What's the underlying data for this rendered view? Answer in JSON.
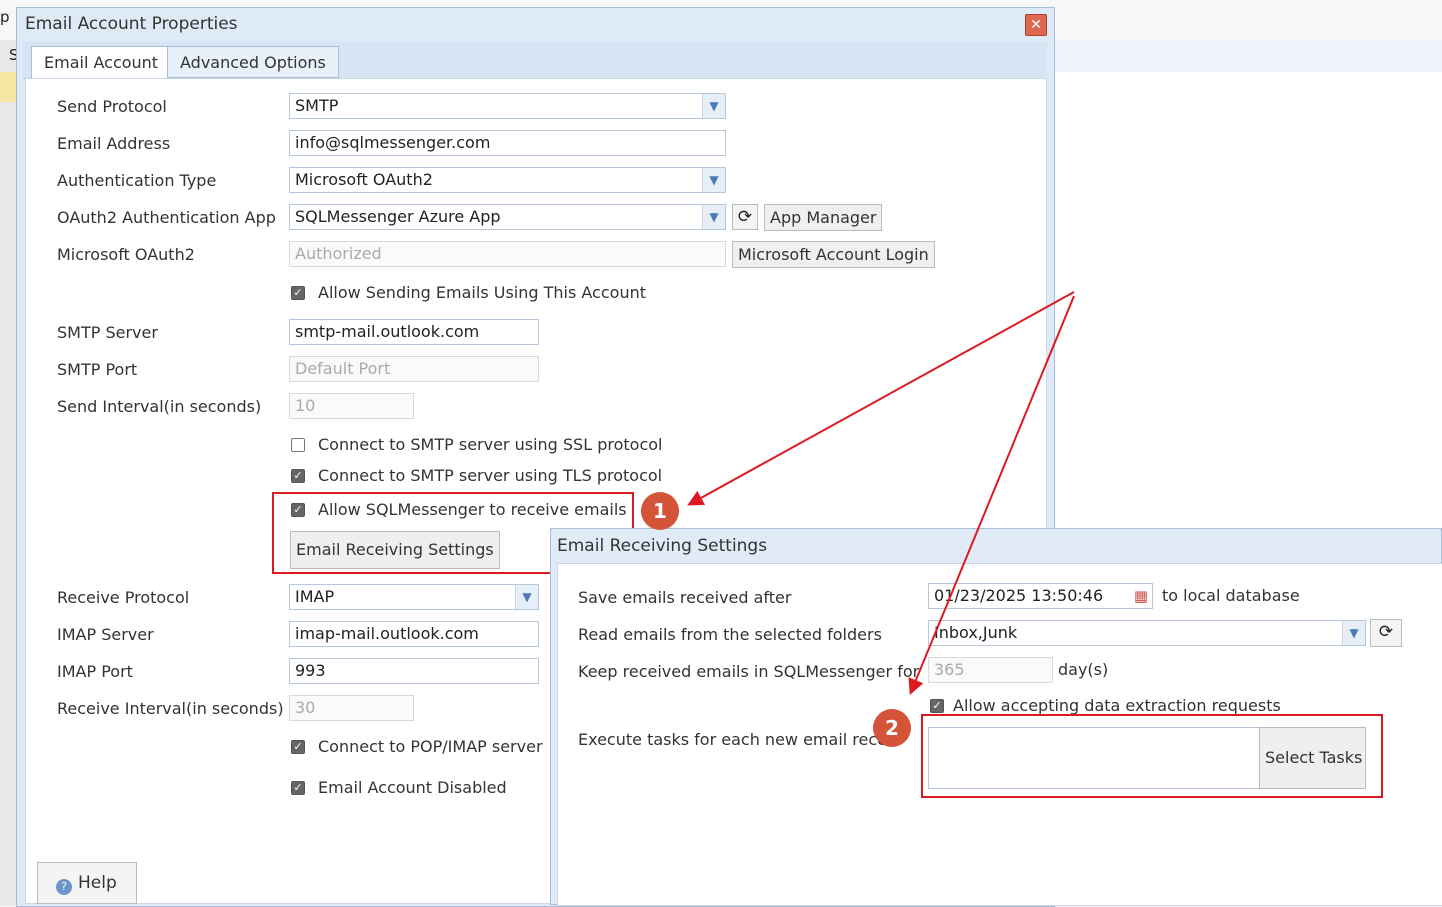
{
  "background": {
    "top_fragment": "p",
    "left_fragment": "S"
  },
  "dialog": {
    "title": "Email Account Properties",
    "close_icon": "close-icon",
    "tabs": [
      {
        "label": "Email Account",
        "active": true
      },
      {
        "label": "Advanced Options",
        "active": false
      }
    ],
    "send_protocol": {
      "label": "Send Protocol",
      "value": "SMTP"
    },
    "email_address": {
      "label": "Email Address",
      "value": "info@sqlmessenger.com"
    },
    "auth_type": {
      "label": "Authentication Type",
      "value": "Microsoft OAuth2"
    },
    "oauth_app": {
      "label": "OAuth2 Authentication App",
      "value": "SQLMessenger Azure App",
      "app_manager": "App Manager"
    },
    "ms_oauth": {
      "label": "Microsoft OAuth2",
      "value": "Authorized",
      "login_button": "Microsoft Account Login"
    },
    "allow_sending": {
      "label": "Allow Sending Emails Using This Account",
      "checked": true
    },
    "smtp_server": {
      "label": "SMTP Server",
      "value": "smtp-mail.outlook.com"
    },
    "smtp_port": {
      "label": "SMTP Port",
      "placeholder": "Default Port"
    },
    "send_interval": {
      "label": "Send Interval(in seconds)",
      "placeholder": "10"
    },
    "ssl": {
      "label": "Connect to SMTP server using SSL protocol",
      "checked": false
    },
    "tls": {
      "label": "Connect to SMTP server using TLS protocol",
      "checked": true
    },
    "allow_receive": {
      "label": "Allow SQLMessenger to receive emails",
      "checked": true
    },
    "receiving_settings_button": "Email Receiving Settings",
    "receive_protocol": {
      "label": "Receive Protocol",
      "value": "IMAP"
    },
    "imap_server": {
      "label": "IMAP Server",
      "value": "imap-mail.outlook.com"
    },
    "imap_port": {
      "label": "IMAP Port",
      "value": "993"
    },
    "receive_interval": {
      "label": "Receive Interval(in seconds)",
      "placeholder": "30"
    },
    "pop_imap": {
      "label": "Connect to POP/IMAP server",
      "checked": true
    },
    "disabled": {
      "label": "Email Account Disabled",
      "checked": true
    },
    "help_button": "Help"
  },
  "receiving_dialog": {
    "title": "Email Receiving Settings",
    "save_after": {
      "label": "Save emails received after",
      "value": "01/23/2025 13:50:46",
      "suffix": "to local database"
    },
    "read_folders": {
      "label": "Read emails from the selected folders",
      "value": "Inbox,Junk"
    },
    "keep_emails": {
      "label": "Keep received emails in SQLMessenger for",
      "placeholder": "365",
      "suffix": "day(s)"
    },
    "allow_extraction": {
      "label": "Allow accepting data extraction requests",
      "checked": true
    },
    "execute_tasks": {
      "label": "Execute tasks for each new email rece",
      "button": "Select Tasks"
    }
  },
  "annotations": {
    "badge1": "1",
    "badge2": "2",
    "color": "#dd1a22",
    "badge_color": "#d4543a"
  }
}
